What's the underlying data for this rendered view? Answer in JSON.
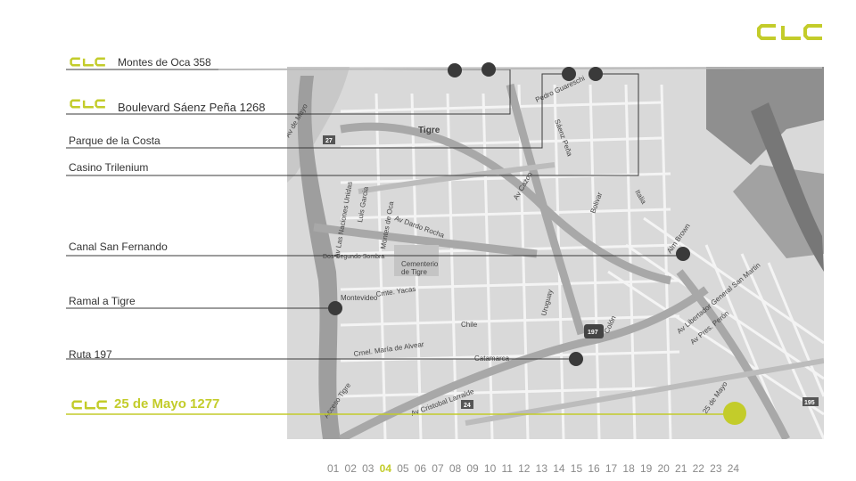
{
  "brand": {
    "name": "CLC",
    "accent_color": "#c3cc2a"
  },
  "locations": [
    {
      "id": "montes",
      "label": "Montes de Oca 358",
      "logo": true
    },
    {
      "id": "saenz",
      "label": "Boulevard Sáenz Peña 1268",
      "logo": true
    },
    {
      "id": "parque",
      "label": "Parque de la Costa",
      "logo": false
    },
    {
      "id": "casino",
      "label": "Casino Trilenium",
      "logo": false
    },
    {
      "id": "canal",
      "label": "Canal  San Fernando",
      "logo": false
    },
    {
      "id": "ramal",
      "label": "Ramal a Tigre",
      "logo": false
    },
    {
      "id": "ruta",
      "label": "Ruta 197",
      "logo": false
    },
    {
      "id": "mayo",
      "label": "25 de Mayo 1277",
      "logo": true,
      "highlight": true
    }
  ],
  "map": {
    "street_labels": [
      "Tigre",
      "Av Cazon",
      "Av Dardo Rocha",
      "Av Las Naciones Unidas",
      "Luis Garcia",
      "Montes de Oca",
      "Cementerio de Tigre",
      "Montevideo",
      "Uruguay",
      "Av Cnel Lynch",
      "Colón",
      "Av Italia",
      "Av Cristobal Larralde",
      "Av Libertador General San Martin",
      "Av Pres. Perón",
      "25 de Mayo",
      "Italia",
      "Alm Brown",
      "Sáenz Peña",
      "Catamarca",
      "Chile",
      "Cmte. Yacas",
      "Dos-Segundo Sombra",
      "Crnel. María de Alvear",
      "Acceso Tigre",
      "Bolivar",
      "Av de Mayo",
      "Pedro Guareschi"
    ],
    "route_shields": [
      "27",
      "197",
      "24",
      "195"
    ]
  },
  "pagination": {
    "pages": [
      "01",
      "02",
      "03",
      "04",
      "05",
      "06",
      "07",
      "08",
      "09",
      "10",
      "11",
      "12",
      "13",
      "14",
      "15",
      "16",
      "17",
      "18",
      "19",
      "20",
      "21",
      "22",
      "23",
      "24"
    ],
    "current": "04"
  }
}
